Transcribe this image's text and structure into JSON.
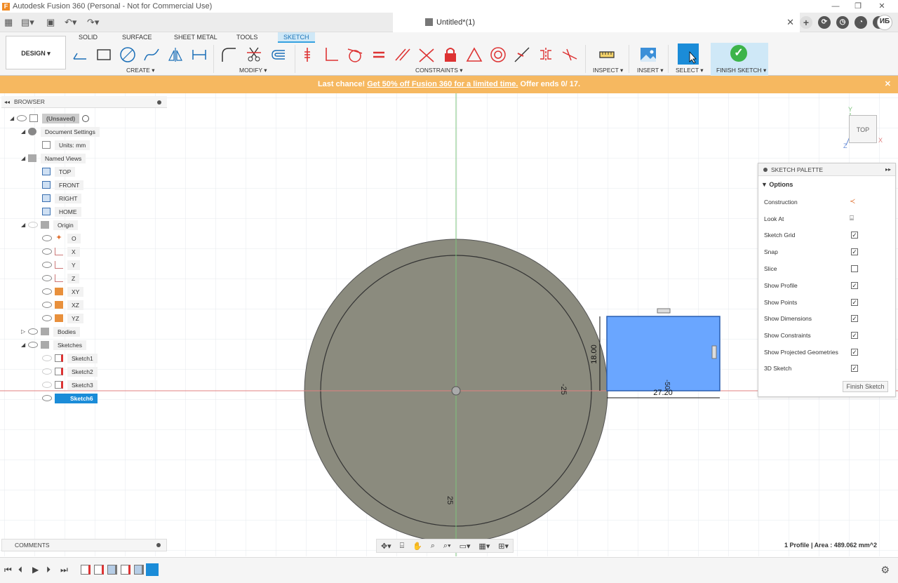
{
  "window": {
    "title": "Autodesk Fusion 360 (Personal - Not for Commercial Use)",
    "minimize": "—",
    "restore": "❐",
    "close": "✕"
  },
  "doc_tab": {
    "title": "Untitled*(1)",
    "close": "✕",
    "add": "+",
    "user_initials": "ИБ"
  },
  "ribbon": {
    "workspace_label": "DESIGN ▾",
    "tabs": [
      "SOLID",
      "SURFACE",
      "SHEET METAL",
      "TOOLS",
      "SKETCH"
    ],
    "active_tab": "SKETCH",
    "groups": {
      "create": "CREATE ▾",
      "modify": "MODIFY ▾",
      "constraints": "CONSTRAINTS ▾",
      "inspect": "INSPECT ▾",
      "insert": "INSERT ▾",
      "select": "SELECT ▾",
      "finish": "FINISH SKETCH ▾"
    }
  },
  "banner": {
    "prefix": "Last chance! ",
    "link": "Get 50% off Fusion 360 for a limited time.",
    "suffix": " Offer ends 0/ 17.",
    "close": "✕"
  },
  "browser": {
    "title": "BROWSER",
    "items": [
      {
        "label": "(Unsaved)",
        "icon": "document-icon"
      },
      {
        "label": "Document Settings",
        "icon": "gear-icon"
      },
      {
        "label": "Units: mm",
        "icon": "document-icon"
      },
      {
        "label": "Named Views",
        "icon": "folder-icon"
      },
      {
        "label": "TOP",
        "icon": "view-icon"
      },
      {
        "label": "FRONT",
        "icon": "view-icon"
      },
      {
        "label": "RIGHT",
        "icon": "view-icon"
      },
      {
        "label": "HOME",
        "icon": "view-icon"
      },
      {
        "label": "Origin",
        "icon": "folder-icon"
      },
      {
        "label": "O",
        "icon": "point-icon"
      },
      {
        "label": "X",
        "icon": "axis-icon"
      },
      {
        "label": "Y",
        "icon": "axis-icon"
      },
      {
        "label": "Z",
        "icon": "axis-icon"
      },
      {
        "label": "XY",
        "icon": "plane-icon"
      },
      {
        "label": "XZ",
        "icon": "plane-icon"
      },
      {
        "label": "YZ",
        "icon": "plane-icon"
      },
      {
        "label": "Bodies",
        "icon": "folder-icon"
      },
      {
        "label": "Sketches",
        "icon": "folder-icon"
      },
      {
        "label": "Sketch1",
        "icon": "sketch-icon"
      },
      {
        "label": "Sketch2",
        "icon": "sketch-icon"
      },
      {
        "label": "Sketch3",
        "icon": "sketch-icon"
      },
      {
        "label": "Sketch6",
        "icon": "sketch-icon"
      }
    ]
  },
  "palette": {
    "title": "SKETCH PALETTE",
    "section": "▼ Options",
    "rows": [
      {
        "label": "Construction",
        "control": "construction-icon"
      },
      {
        "label": "Look At",
        "control": "look-at-icon"
      },
      {
        "label": "Sketch Grid",
        "checked": true
      },
      {
        "label": "Snap",
        "checked": true
      },
      {
        "label": "Slice",
        "checked": false
      },
      {
        "label": "Show Profile",
        "checked": true
      },
      {
        "label": "Show Points",
        "checked": true
      },
      {
        "label": "Show Dimensions",
        "checked": true
      },
      {
        "label": "Show Constraints",
        "checked": true
      },
      {
        "label": "Show Projected Geometries",
        "checked": true
      },
      {
        "label": "3D Sketch",
        "checked": true
      }
    ],
    "finish_button": "Finish Sketch"
  },
  "viewcube": {
    "face": "TOP",
    "axis_y": "Y",
    "axis_x": "X",
    "axis_z": "Z"
  },
  "sketch": {
    "dim_height": "18.00",
    "dim_width": "27.20",
    "dim_radius_right": "-25",
    "dim_radius_bottom": "25",
    "dim_small": "-50"
  },
  "comments": {
    "title": "COMMENTS"
  },
  "status": {
    "text": "1 Profile | Area : 489.062 mm^2"
  },
  "colors": {
    "accent": "#1b8cd8",
    "banner": "#f6b860",
    "profile_fill": "#6aa6ff",
    "disc_fill": "#8b8b7e",
    "finish_green": "#3cb44a"
  }
}
